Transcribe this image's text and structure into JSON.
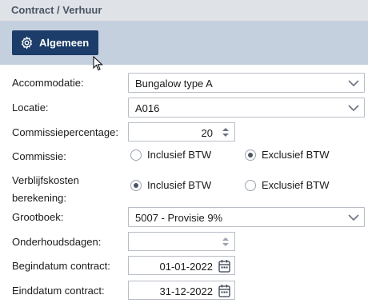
{
  "header": {
    "title": "Contract / Verhuur"
  },
  "tabs": {
    "active_label": "Algemeen",
    "active_icon": "gear-icon"
  },
  "form": {
    "accommodatie": {
      "label": "Accommodatie:",
      "value": "Bungalow type A"
    },
    "locatie": {
      "label": "Locatie:",
      "value": "A016"
    },
    "commissiepercentage": {
      "label": "Commissiepercentage:",
      "value": "20"
    },
    "commissie": {
      "label": "Commissie:",
      "options": [
        "Inclusief BTW",
        "Exclusief BTW"
      ],
      "selected": "Exclusief BTW"
    },
    "verblijfskosten": {
      "label_line1": "Verblijfskosten",
      "label_line2": "berekening:",
      "options": [
        "Inclusief BTW",
        "Exclusief BTW"
      ],
      "selected": "Inclusief BTW"
    },
    "grootboek": {
      "label": "Grootboek:",
      "value": "5007 - Provisie 9%"
    },
    "onderhoudsdagen": {
      "label": "Onderhoudsdagen:",
      "value": ""
    },
    "begindatum": {
      "label": "Begindatum contract:",
      "value": "01-01-2022"
    },
    "einddatum": {
      "label": "Einddatum contract:",
      "value": "31-12-2022"
    }
  },
  "colors": {
    "primary_button": "#1c3d69",
    "tab_bar": "#c5d0df",
    "title_bar": "#dfe2e7"
  }
}
